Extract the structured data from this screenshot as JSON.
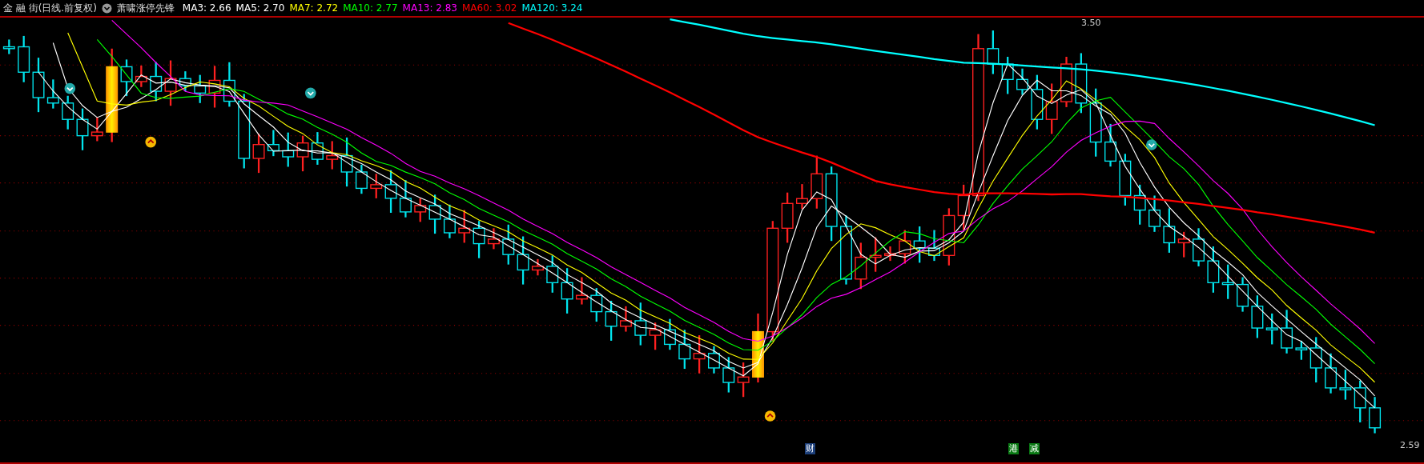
{
  "header": {
    "title": "金 融 街(日线.前复权)",
    "indicator": "萧啸涨停先锋",
    "moving_averages": [
      {
        "label": "MA3: 2.66",
        "color": "#ffffff"
      },
      {
        "label": "MA5: 2.70",
        "color": "#ffffff"
      },
      {
        "label": "MA7: 2.72",
        "color": "#ffff00"
      },
      {
        "label": "MA10: 2.77",
        "color": "#00ff00"
      },
      {
        "label": "MA13: 2.83",
        "color": "#ff00ff"
      },
      {
        "label": "MA60: 3.02",
        "color": "#ff0000"
      },
      {
        "label": "MA120: 3.24",
        "color": "#00ffff"
      }
    ]
  },
  "chart": {
    "high_label": "3.50",
    "low_label": "2.59",
    "event_markers": [
      {
        "text": "财",
        "color": "#1c3f7a"
      },
      {
        "text": "港",
        "color": "#0a7a14"
      },
      {
        "text": "减",
        "color": "#0a7a14"
      }
    ]
  }
}
